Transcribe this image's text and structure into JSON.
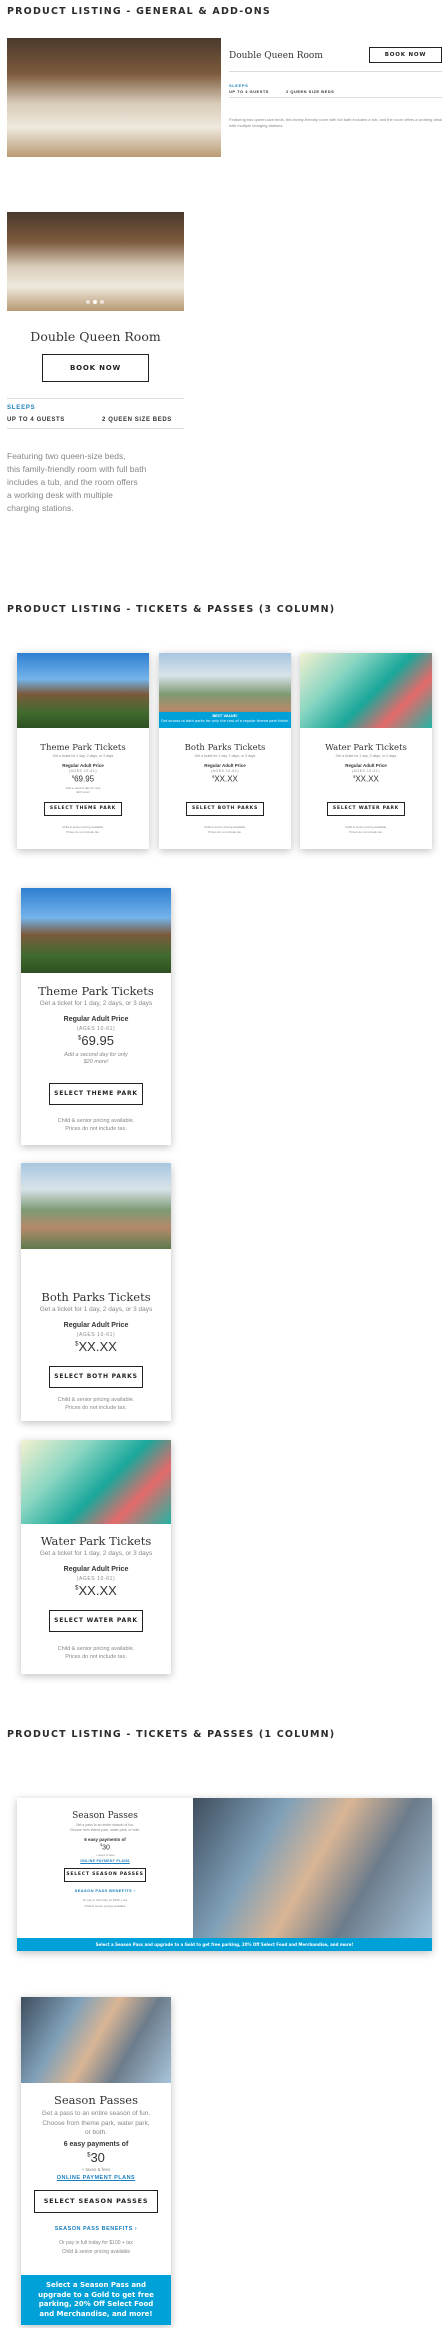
{
  "headings": {
    "general": "PRODUCT LISTING - GENERAL & ADD-ONS",
    "three_col": "PRODUCT LISTING - TICKETS & PASSES (3 COLUMN)",
    "one_col": "PRODUCT LISTING - TICKETS & PASSES (1 COLUMN)"
  },
  "room": {
    "name": "Double Queen Room",
    "book_label": "BOOK NOW",
    "sleeps_label": "SLEEPS",
    "guests": "UP TO 4 GUESTS",
    "beds": "2 QUEEN SIZE BEDS",
    "description": "Featuring two queen-size beds, this family-friendly room with full bath includes a tub, and the room offers a working desk with multiple charging stations.",
    "desc_lines": [
      "Featuring two queen-size beds,",
      "this family-friendly room with full bath",
      "includes a tub, and the room offers",
      "a working desk with multiple",
      "charging stations."
    ]
  },
  "tickets": [
    {
      "title": "Theme Park Tickets",
      "subtitle": "Get a ticket for 1 day, 2 days, or 3 days",
      "price_label": "Regular Adult Price",
      "ages": "(AGES 10-61)",
      "currency": "$",
      "price": "69.95",
      "note_lines": [
        "Add a second day for only",
        "$20 more!"
      ],
      "button": "SELECT THEME PARK",
      "fine_lines": [
        "Child & senior pricing available.",
        "Prices do not include tax."
      ],
      "badge": null
    },
    {
      "title": "Both Parks Tickets",
      "subtitle": "Get a ticket for 1 day, 2 days, or 3 days",
      "price_label": "Regular Adult Price",
      "ages": "(AGES 10-61)",
      "currency": "$",
      "price": "XX.XX",
      "note_lines": [],
      "button": "SELECT BOTH PARKS",
      "fine_lines": [
        "Child & senior pricing available.",
        "Prices do not include tax."
      ],
      "badge": {
        "title": "BEST VALUE!",
        "text": "Get access to both parks for only the cost of a regular theme park ticket."
      }
    },
    {
      "title": "Water Park Tickets",
      "subtitle": "Get a ticket for 1 day, 2 days, or 3 days",
      "price_label": "Regular Adult Price",
      "ages": "(AGES 10-61)",
      "currency": "$",
      "price": "XX.XX",
      "note_lines": [],
      "button": "SELECT WATER PARK",
      "fine_lines": [
        "Child & senior pricing available.",
        "Prices do not include tax."
      ],
      "badge": null
    }
  ],
  "season": {
    "title": "Season Passes",
    "desc_desktop_lines": [
      "Get a pass to an entire season of fun.",
      "Choose from theme park, water park, or both."
    ],
    "desc_mobile_lines": [
      "Get a pass to an entire season of fun.",
      "Choose from theme park, water park,",
      "or both."
    ],
    "payments_label": "6 easy payments of",
    "currency": "$",
    "amount": "30",
    "fees": "+ taxes & fees",
    "plans_link": "ONLINE PAYMENT PLANS",
    "button": "SELECT SEASON PASSES",
    "benefits_link": "SEASON PASS BENEFITS",
    "pay_full": "Or pay in full today for $100 + tax",
    "pricing_note": "Child & senior pricing available",
    "strip_desktop": "Select a Season Pass and upgrade to a Gold to get free parking, 20% Off Select Food and Merchandise, and more!",
    "strip_mobile_lines": [
      "Select a Season Pass and",
      "upgrade to a Gold to get free",
      "parking, 20% Off Select Food",
      "and Merchandise, and more!"
    ]
  },
  "colors": {
    "accent": "#00a0d8",
    "link": "#1a7fc1",
    "text": "#333333"
  }
}
